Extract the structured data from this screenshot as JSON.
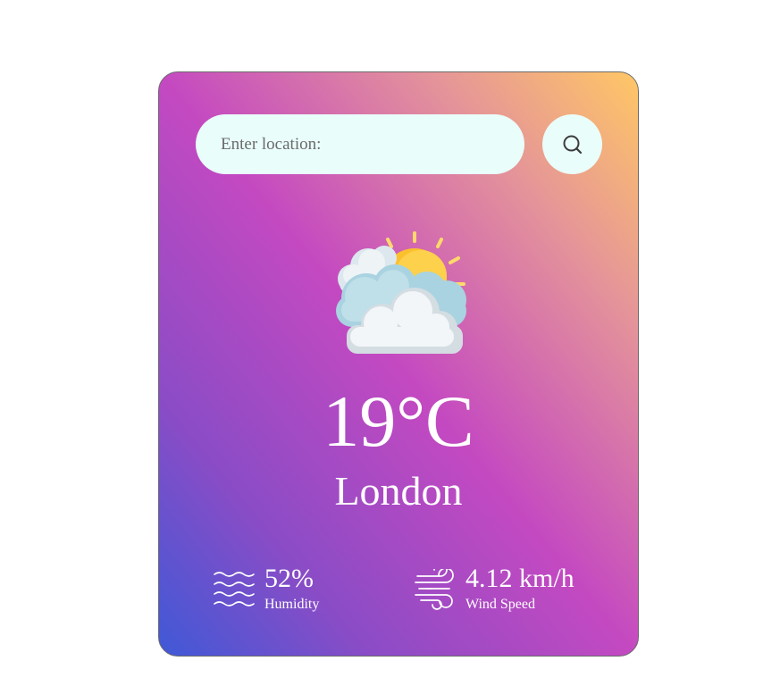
{
  "search": {
    "placeholder": "Enter location:",
    "value": "",
    "button_icon": "search-icon"
  },
  "weather": {
    "icon": "partly-cloudy-icon",
    "temperature": "19°C",
    "city": "London"
  },
  "stats": {
    "humidity": {
      "icon": "humidity-waves-icon",
      "value": "52%",
      "label": "Humidity"
    },
    "wind": {
      "icon": "wind-icon",
      "value": "4.12 km/h",
      "label": "Wind Speed"
    }
  },
  "colors": {
    "gradient_bottom_left": "#3f59d7",
    "gradient_middle": "#c449c1",
    "gradient_top_right": "#ffc765",
    "input_background": "#e9fdfa",
    "text": "#ffffff"
  }
}
